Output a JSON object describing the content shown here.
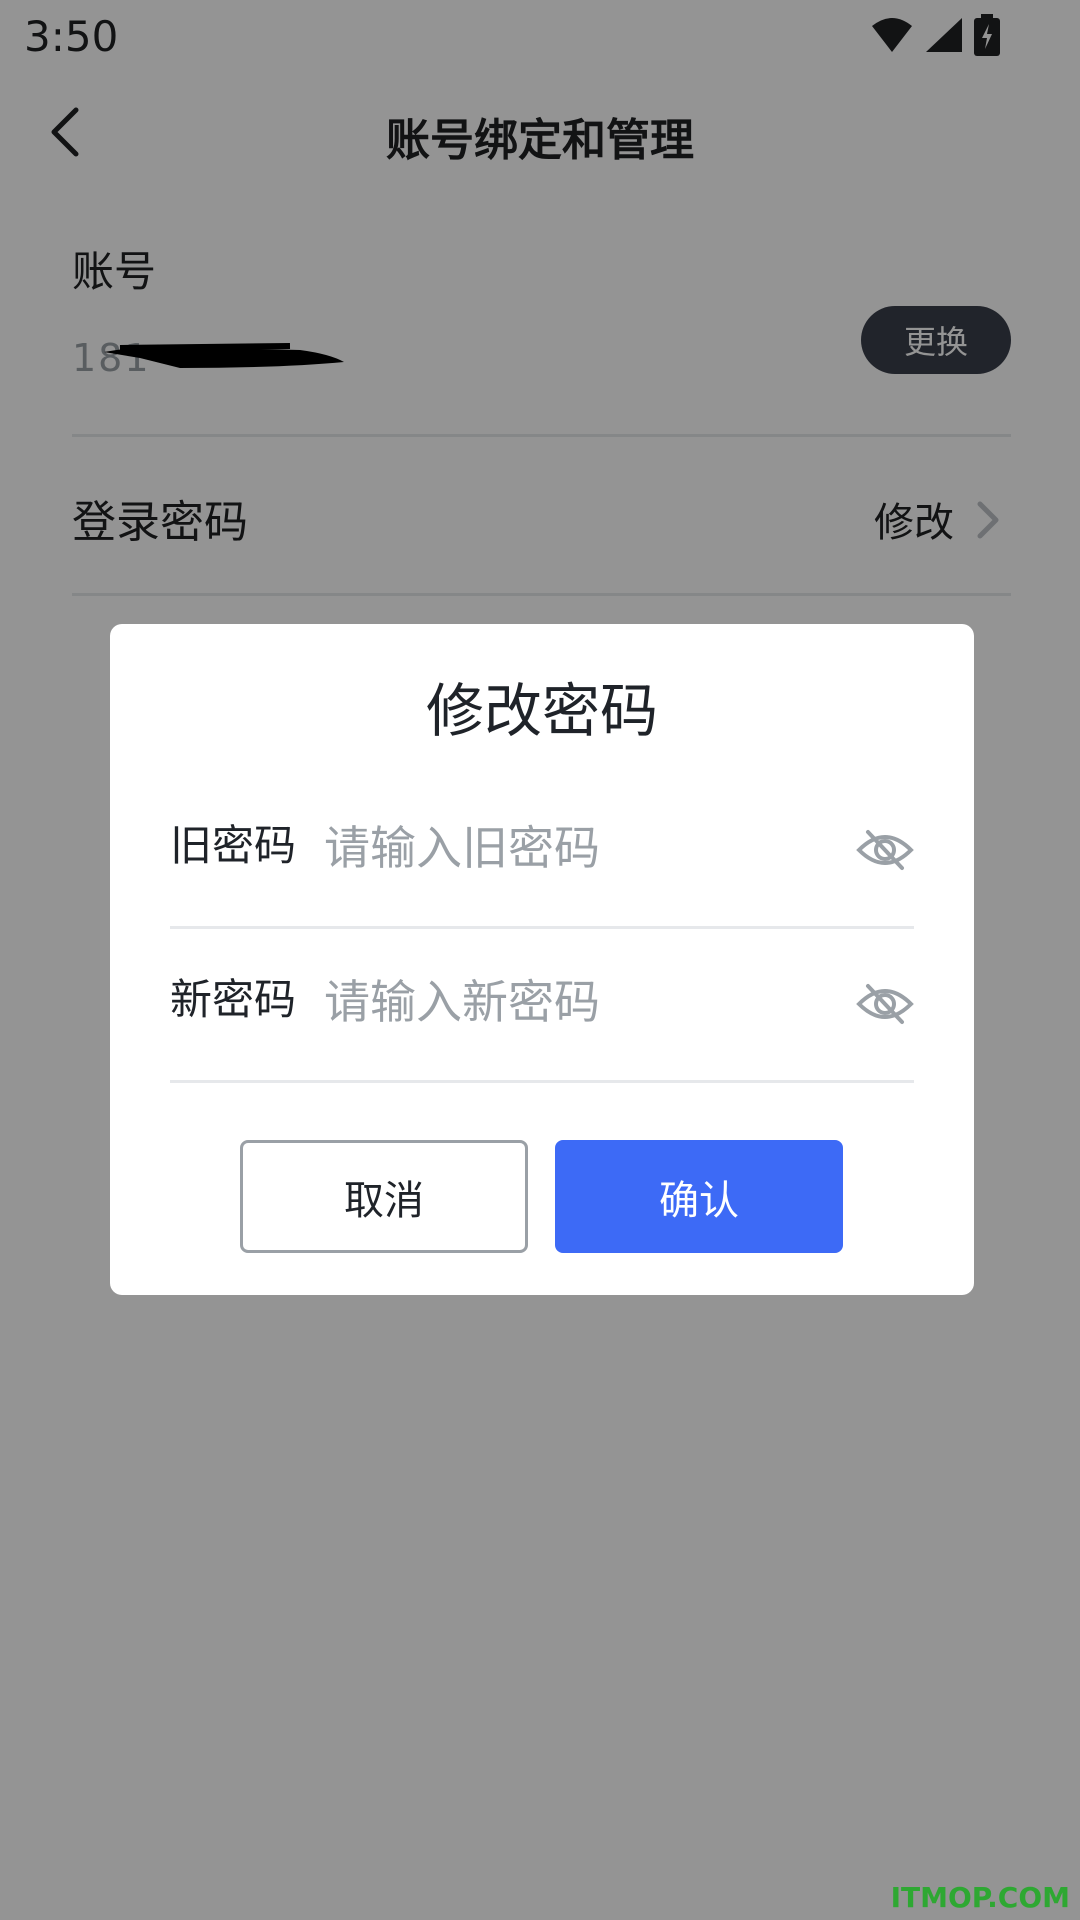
{
  "status_bar": {
    "time": "3:50",
    "icons": [
      "wifi-icon",
      "signal-icon",
      "battery-charging-icon"
    ]
  },
  "nav": {
    "back_icon": "back-chevron-icon",
    "title": "账号绑定和管理"
  },
  "account": {
    "label": "账号",
    "value_visible": "181",
    "change_button": "更换"
  },
  "password_row": {
    "label": "登录密码",
    "action": "修改",
    "chevron_icon": "chevron-right-icon"
  },
  "dialog": {
    "title": "修改密码",
    "old_password": {
      "label": "旧密码",
      "placeholder": "请输入旧密码",
      "value": "",
      "icon": "eye-hidden-icon"
    },
    "new_password": {
      "label": "新密码",
      "placeholder": "请输入新密码",
      "value": "",
      "icon": "eye-hidden-icon"
    },
    "cancel_button": "取消",
    "confirm_button": "确认"
  },
  "colors": {
    "accent": "#3d6af6",
    "overlay": "rgba(0,0,0,0.42)",
    "dark_button": "#3a3f4b",
    "watermark": "#2ea832"
  },
  "watermark": "ITMOP.COM"
}
